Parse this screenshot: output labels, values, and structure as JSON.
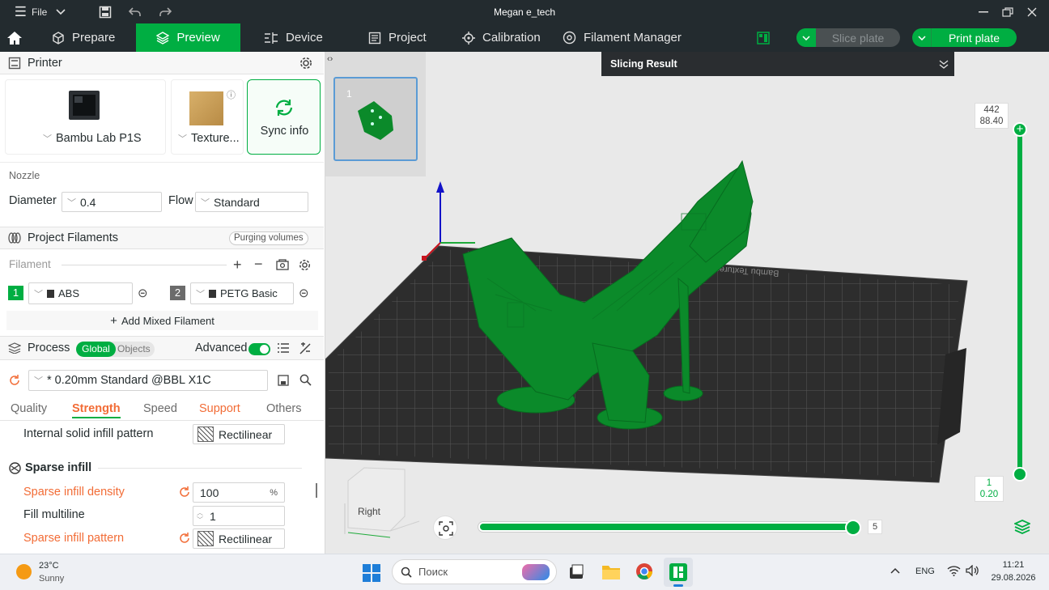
{
  "titlebar": {
    "menu_label": "File",
    "title": "Megan e_tech"
  },
  "nav": {
    "tabs": [
      {
        "label": "Prepare"
      },
      {
        "label": "Preview"
      },
      {
        "label": "Device"
      },
      {
        "label": "Project"
      },
      {
        "label": "Calibration"
      },
      {
        "label": "Filament Manager"
      }
    ],
    "slice_plate": "Slice plate",
    "print_plate": "Print plate"
  },
  "printer": {
    "header": "Printer",
    "name": "Bambu Lab P1S",
    "plate": "Texture...",
    "sync": "Sync info",
    "nozzle_title": "Nozzle",
    "diameter_label": "Diameter",
    "diameter_value": "0.4",
    "flow_label": "Flow",
    "flow_value": "Standard"
  },
  "filaments": {
    "header": "Project Filaments",
    "purging": "Purging volumes",
    "label": "Filament",
    "items": [
      {
        "num": "1",
        "name": "ABS",
        "color": "#00ae42"
      },
      {
        "num": "2",
        "name": "PETG Basic",
        "color": "#6b6b6b"
      }
    ],
    "add_mixed": "Add Mixed Filament"
  },
  "process": {
    "header": "Process",
    "global": "Global",
    "objects": "Objects",
    "advanced": "Advanced",
    "preset": "* 0.20mm Standard @BBL X1C",
    "tabs": [
      "Quality",
      "Strength",
      "Speed",
      "Support",
      "Others"
    ],
    "internal_solid_label": "Internal solid infill pattern",
    "internal_solid_value": "Rectilinear",
    "sparse_title": "Sparse infill",
    "density_label": "Sparse infill density",
    "density_value": "100",
    "density_unit": "%",
    "multiline_label": "Fill multiline",
    "multiline_value": "1",
    "pattern_label": "Sparse infill pattern",
    "pattern_value": "Rectilinear"
  },
  "viewport": {
    "slicing_result": "Slicing Result",
    "plate_num": "1",
    "layer_top_num": "442",
    "layer_top_height": "88.40",
    "layer_bottom_num": "1",
    "layer_bottom_height": "0.20",
    "move_value": "5",
    "cube_label": "Right",
    "bed_text": "Bambu Textured PEI Plate"
  },
  "taskbar": {
    "temp": "23°C",
    "weather": "Sunny",
    "search": "Поиск",
    "lang": "ENG",
    "time": "11:21",
    "date": "29.08.2026"
  },
  "colors": {
    "accent": "#00ae42",
    "dark": "#232b2f",
    "orange": "#f26c36"
  }
}
